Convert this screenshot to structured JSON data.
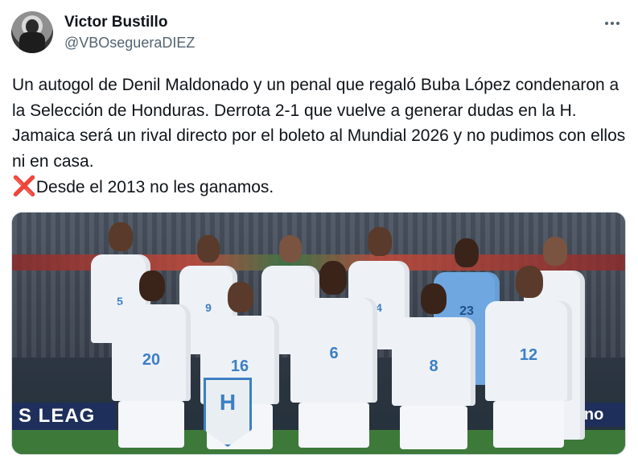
{
  "author": {
    "name": "Victor Bustillo",
    "handle": "@VBOsegueraDIEZ"
  },
  "tweet": {
    "text": "Un autogol de Denil Maldonado y un penal que regaló Buba López condenaron a la Selección de Honduras. Derrota 2-1 que vuelve a generar dudas en la H. Jamaica será un rival directo por el boleto al Mundial 2026 y no pudimos con ellos ni en casa.",
    "line2_emoji": "❌",
    "line2_text": "Desde el 2013 no les ganamos."
  },
  "media": {
    "board_left": "S LEAG",
    "board_right": "nno",
    "pennant_letter": "H",
    "back_row_numbers": [
      "5",
      "9",
      "",
      "4",
      "23",
      ""
    ],
    "front_row_numbers": [
      "20",
      "16",
      "6",
      "8",
      "12"
    ]
  },
  "icons": {
    "more": "more-horizontal-icon",
    "x": "cross-mark-icon"
  }
}
